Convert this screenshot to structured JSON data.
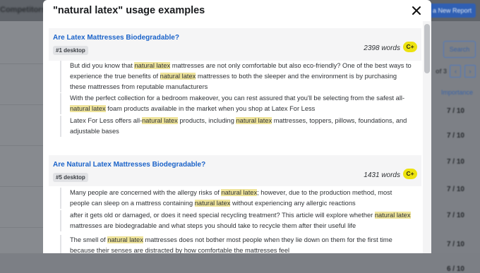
{
  "background": {
    "left_header": "Competitors",
    "new_report_button": "te a New Report",
    "search_button": "Search",
    "pager_text": "of 3",
    "pager_prev": "‹",
    "pager_next": "›",
    "importance_header": "Importance",
    "scores": [
      "7 / 10",
      "7 / 10",
      "7 / 10",
      "7 / 10",
      "7 / 10",
      "7 / 10",
      "6 / 10"
    ]
  },
  "modal": {
    "title": "\"natural latex\" usage examples",
    "close_icon": "close-icon",
    "highlight_color": "#efe49b",
    "grade_color": "#ece20f",
    "results": [
      {
        "title": "Are Latex Mattresses Biodegradable?",
        "badge": "#1 desktop",
        "words": "2398 words",
        "grade": "C+",
        "examples": [
          [
            {
              "t": "But did you know that "
            },
            {
              "t": "natural latex",
              "hl": true
            },
            {
              "t": " mattresses are not only comfortable but also eco-friendly? One of the best ways to experience the true benefits of "
            },
            {
              "t": "natural latex",
              "hl": true
            },
            {
              "t": " mattresses to both the sleeper and the environment is by purchasing these mattresses from reputable manufacturers"
            }
          ],
          [
            {
              "t": "With the perfect collection for a bedroom makeover, you can rest assured that you'll be selecting from the safest all-"
            },
            {
              "t": "natural latex",
              "hl": true
            },
            {
              "t": " foam products available in the market when you shop at Latex For Less"
            }
          ],
          [
            {
              "t": "Latex For Less offers all-"
            },
            {
              "t": "natural latex",
              "hl": true
            },
            {
              "t": " products, including "
            },
            {
              "t": "natural latex",
              "hl": true
            },
            {
              "t": " mattresses, toppers, pillows, foundations, and adjustable bases"
            }
          ]
        ]
      },
      {
        "title": "Are Natural Latex Mattresses Biodegradable?",
        "badge": "#5 desktop",
        "words": "1431 words",
        "grade": "C+",
        "examples": [
          [
            {
              "t": "Many people are concerned with the allergy risks of "
            },
            {
              "t": "natural latex",
              "hl": true
            },
            {
              "t": "; however, due to the production method, most people can sleep on a mattress containing "
            },
            {
              "t": "natural latex",
              "hl": true
            },
            {
              "t": " without experiencing any allergic reactions"
            }
          ],
          [
            {
              "t": "after it gets old or damaged, or does it need special recycling treatment? This article will explore whether "
            },
            {
              "t": "natural latex",
              "hl": true
            },
            {
              "t": " mattresses are biodegradable and what steps you should take to recycle them after their useful life"
            }
          ],
          [
            {
              "t": "The smell of "
            },
            {
              "t": "natural latex",
              "hl": true
            },
            {
              "t": " mattresses does not bother most people when they lie down on them for the first time because their senses are distracted by how comfortable the mattresses feel"
            }
          ]
        ]
      }
    ]
  }
}
